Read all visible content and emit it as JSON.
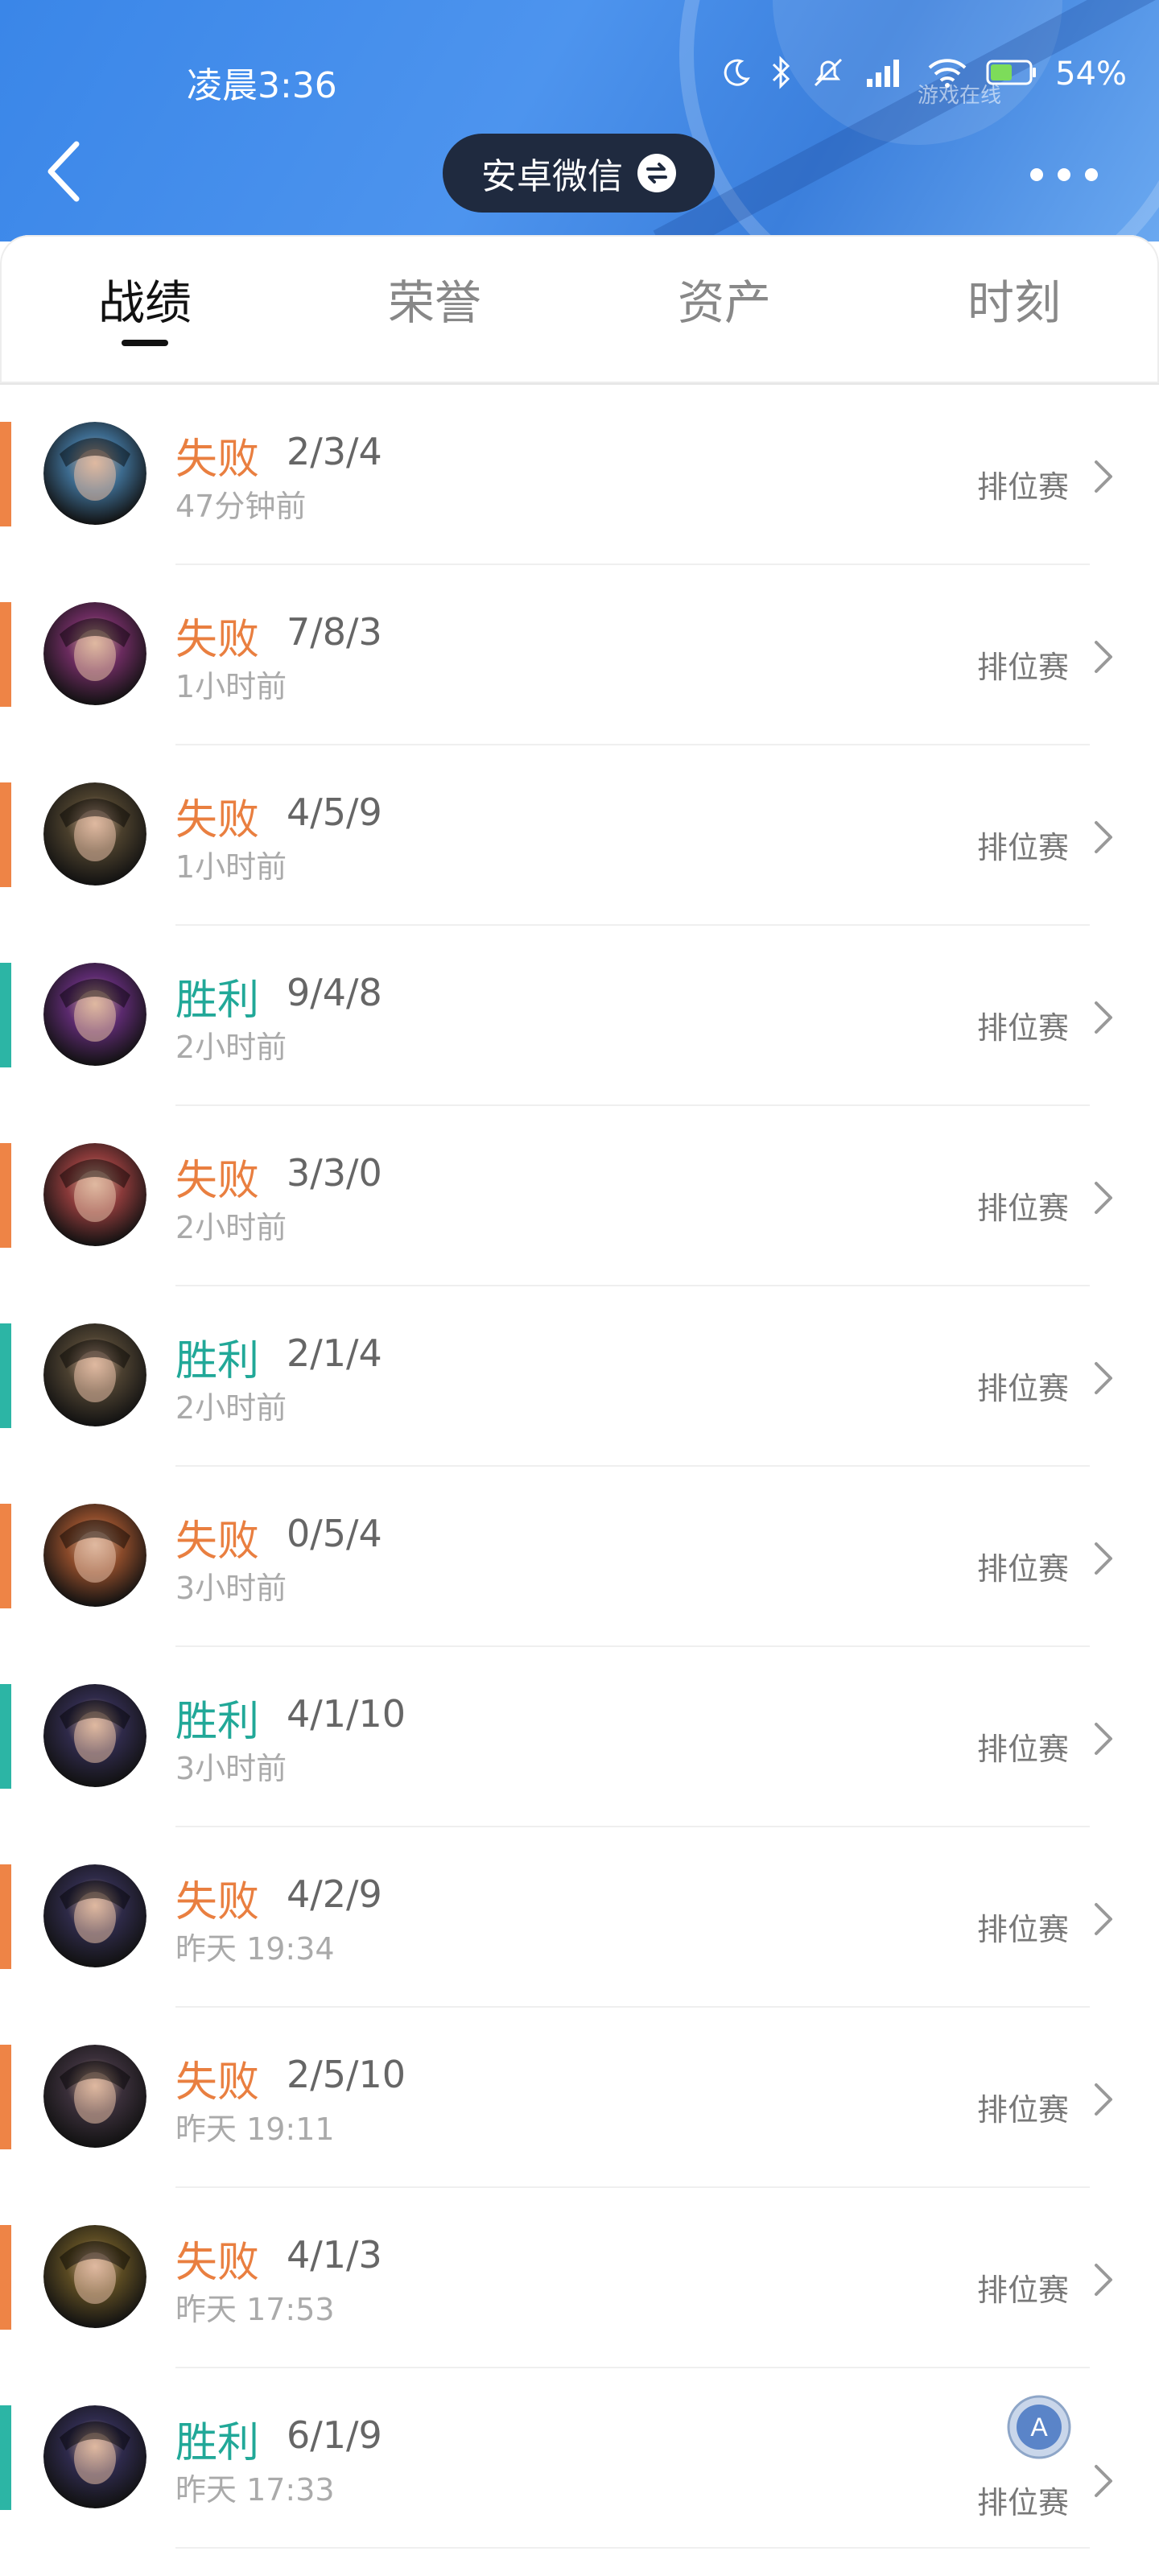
{
  "status_bar": {
    "time": "凌晨3:36",
    "battery": "54%",
    "watermark": "游戏在线",
    "icons": [
      "moon-icon",
      "bluetooth-icon",
      "mute-bell-icon",
      "hd-signal-icon",
      "wifi-icon",
      "battery-icon"
    ]
  },
  "header": {
    "back_icon": "chevron-left-icon",
    "pill_label": "安卓微信",
    "pill_icon": "swap-icon",
    "more_icon": "more-dots-icon",
    "colors": {
      "accent": "#3a86e8",
      "pill_bg": "#1f2a3f"
    }
  },
  "tabs": [
    {
      "label": "战绩",
      "active": true
    },
    {
      "label": "荣誉",
      "active": false
    },
    {
      "label": "资产",
      "active": false
    },
    {
      "label": "时刻",
      "active": false
    }
  ],
  "colors": {
    "loss": "#e97f40",
    "win": "#21a898"
  },
  "matches": [
    {
      "result": "失败",
      "outcome": "loss",
      "kda": "2/3/4",
      "time": "47分钟前",
      "mode": "排位赛",
      "avatar_hue": "#3d6b8f"
    },
    {
      "result": "失败",
      "outcome": "loss",
      "kda": "7/8/3",
      "time": "1小时前",
      "mode": "排位赛",
      "avatar_hue": "#6a2b5e"
    },
    {
      "result": "失败",
      "outcome": "loss",
      "kda": "4/5/9",
      "time": "1小时前",
      "mode": "排位赛",
      "avatar_hue": "#4a3f2c"
    },
    {
      "result": "胜利",
      "outcome": "win",
      "kda": "9/4/8",
      "time": "2小时前",
      "mode": "排位赛",
      "avatar_hue": "#5b2a6e"
    },
    {
      "result": "失败",
      "outcome": "loss",
      "kda": "3/3/0",
      "time": "2小时前",
      "mode": "排位赛",
      "avatar_hue": "#8a3a3a"
    },
    {
      "result": "胜利",
      "outcome": "win",
      "kda": "2/1/4",
      "time": "2小时前",
      "mode": "排位赛",
      "avatar_hue": "#4b4030"
    },
    {
      "result": "失败",
      "outcome": "loss",
      "kda": "0/5/4",
      "time": "3小时前",
      "mode": "排位赛",
      "avatar_hue": "#8a4a2a"
    },
    {
      "result": "胜利",
      "outcome": "win",
      "kda": "4/1/10",
      "time": "3小时前",
      "mode": "排位赛",
      "avatar_hue": "#2f2a4a"
    },
    {
      "result": "失败",
      "outcome": "loss",
      "kda": "4/2/9",
      "time": "昨天 19:34",
      "mode": "排位赛",
      "avatar_hue": "#2e2a48"
    },
    {
      "result": "失败",
      "outcome": "loss",
      "kda": "2/5/10",
      "time": "昨天 19:11",
      "mode": "排位赛",
      "avatar_hue": "#3a2f3a"
    },
    {
      "result": "失败",
      "outcome": "loss",
      "kda": "4/1/3",
      "time": "昨天 17:53",
      "mode": "排位赛",
      "avatar_hue": "#5a4a22"
    },
    {
      "result": "胜利",
      "outcome": "win",
      "kda": "6/1/9",
      "time": "昨天 17:33",
      "mode": "排位赛",
      "avatar_hue": "#2e2a4c",
      "badge": "A"
    }
  ]
}
